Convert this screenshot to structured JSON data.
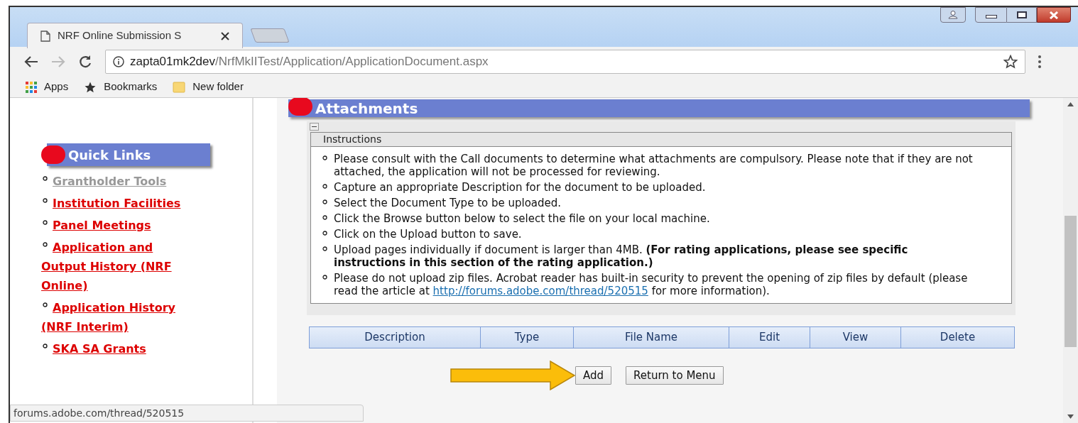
{
  "browser": {
    "tab_title": "NRF Online Submission S",
    "address_host": "zapta01mk2dev",
    "address_path": "/NrfMkIITest/Application/ApplicationDocument.aspx",
    "bookmarks": [
      {
        "kind": "apps",
        "label": "Apps"
      },
      {
        "kind": "star",
        "label": "Bookmarks"
      },
      {
        "kind": "folder",
        "label": "New folder"
      }
    ],
    "status_url": "forums.adobe.com/thread/520515"
  },
  "sidebar": {
    "title": "Quick Links",
    "links": [
      {
        "label": "Grantholder Tools",
        "visited": true
      },
      {
        "label": "Institution Facilities",
        "visited": false
      },
      {
        "label": "Panel Meetings",
        "visited": false
      },
      {
        "label": "Application and Output History (NRF Online)",
        "visited": false
      },
      {
        "label": "Application History (NRF Interim)",
        "visited": false
      },
      {
        "label": "SKA SA Grants",
        "visited": false
      }
    ]
  },
  "section": {
    "title": "Attachments",
    "instructions_title": "Instructions",
    "instructions": [
      {
        "kind": "text",
        "text": "Please consult with the Call documents to determine what attachments are compulsory. Please note that if they are not attached, the application will not be processed for reviewing."
      },
      {
        "kind": "text",
        "text": "Capture an appropriate Description for the document to be uploaded."
      },
      {
        "kind": "text",
        "text": "Select the Document Type to be uploaded."
      },
      {
        "kind": "text",
        "text": "Click the Browse button below to select the file on your local machine."
      },
      {
        "kind": "text",
        "text": "Click on the Upload button to save."
      },
      {
        "kind": "text",
        "text": "Upload pages individually if document is larger than 4MB. **(For rating applications, please see specific instructions in this section of the rating application.)**"
      },
      {
        "kind": "link",
        "before": "Please do not upload zip files. Acrobat reader has built-in security to prevent the opening of zip files by default (please read the article at",
        "link": "http://forums.adobe.com/thread/520515",
        "after": "for more information)."
      }
    ],
    "table_columns": [
      "Description",
      "Type",
      "File Name",
      "Edit",
      "View",
      "Delete"
    ],
    "buttons": [
      "Add",
      "Return to Menu"
    ]
  }
}
